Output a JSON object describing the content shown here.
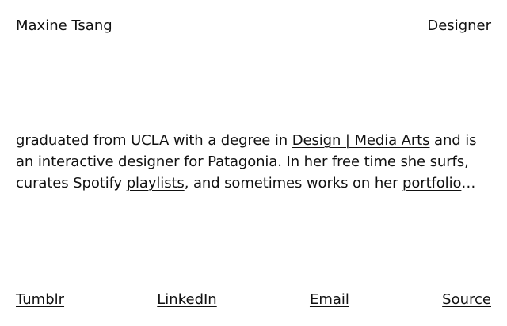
{
  "header": {
    "name": "Maxine Tsang",
    "role": "Designer"
  },
  "bio": {
    "t1": "graduated from UCLA with a degree in ",
    "link_major": "Design | Media Arts",
    "t2": " and is an interactive designer for ",
    "link_employer": "Patagonia",
    "t3": ". In her free time she ",
    "link_surfs": "surfs",
    "t4": ", curates Spotify ",
    "link_playlists": "playlists",
    "t5": ", and sometimes works on her ",
    "link_portfolio": "portfolio",
    "t6": "…"
  },
  "footer": {
    "links": [
      "Tumblr",
      "LinkedIn",
      "Email",
      "Source"
    ]
  },
  "colors": {
    "text": "#111111",
    "background": "#ffffff"
  }
}
